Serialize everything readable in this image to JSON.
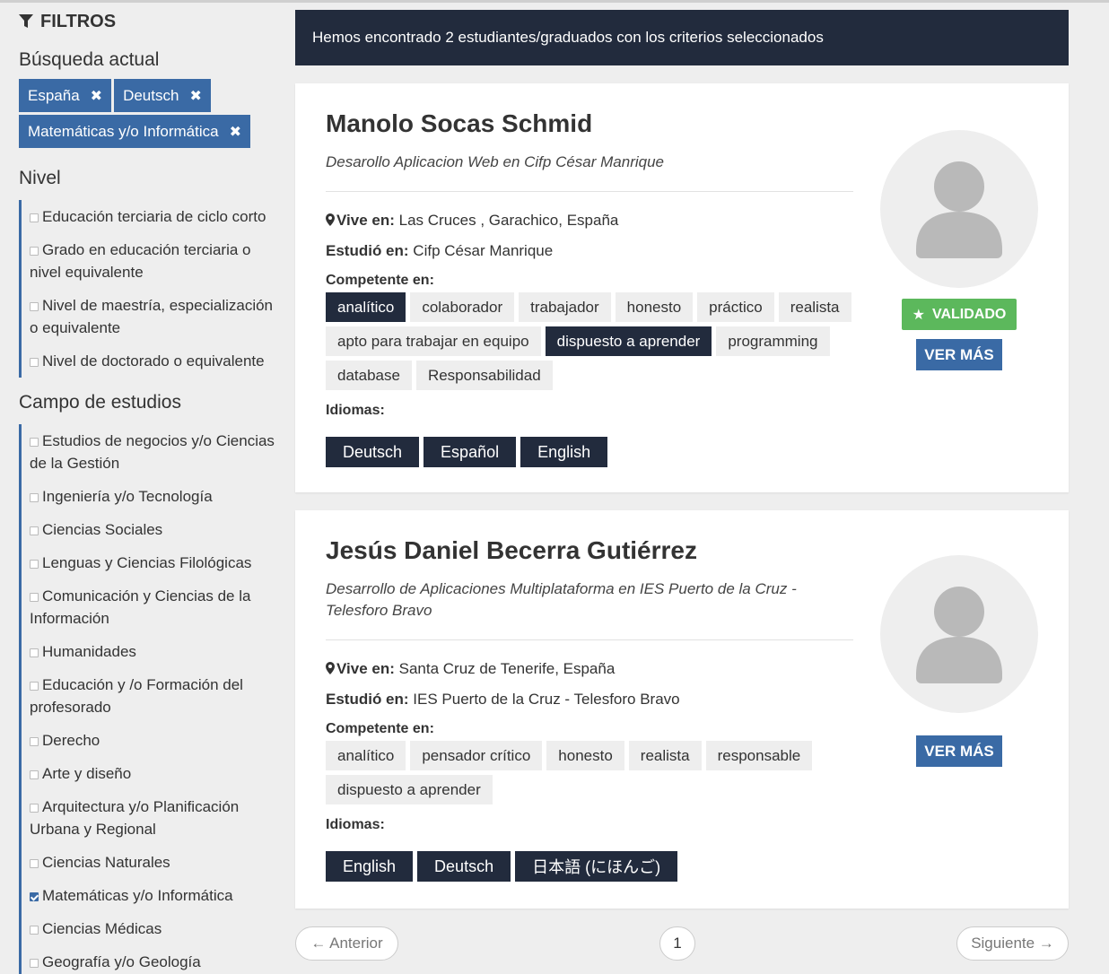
{
  "sidebar": {
    "title": "FILTROS",
    "current_search_title": "Búsqueda actual",
    "chips": [
      {
        "label": "España"
      },
      {
        "label": "Deutsch"
      },
      {
        "label": "Matemáticas y/o Informática"
      }
    ],
    "level_title": "Nivel",
    "levels": [
      {
        "label": "Educación terciaria de ciclo corto",
        "checked": false
      },
      {
        "label": "Grado en educación terciaria o nivel equivalente",
        "checked": false
      },
      {
        "label": "Nivel de maestría, especialización o equivalente",
        "checked": false
      },
      {
        "label": "Nivel de doctorado o equivalente",
        "checked": false
      }
    ],
    "field_title": "Campo de estudios",
    "fields": [
      {
        "label": "Estudios de negocios y/o Ciencias de la Gestión",
        "checked": false
      },
      {
        "label": "Ingeniería y/o Tecnología",
        "checked": false
      },
      {
        "label": "Ciencias Sociales",
        "checked": false
      },
      {
        "label": "Lenguas y Ciencias Filológicas",
        "checked": false
      },
      {
        "label": "Comunicación y Ciencias de la Información",
        "checked": false
      },
      {
        "label": "Humanidades",
        "checked": false
      },
      {
        "label": "Educación y /o Formación del profesorado",
        "checked": false
      },
      {
        "label": "Derecho",
        "checked": false
      },
      {
        "label": "Arte y diseño",
        "checked": false
      },
      {
        "label": "Arquitectura y/o Planificación Urbana y Regional",
        "checked": false
      },
      {
        "label": "Ciencias Naturales",
        "checked": false
      },
      {
        "label": "Matemáticas y/o Informática",
        "checked": true
      },
      {
        "label": "Ciencias Médicas",
        "checked": false
      },
      {
        "label": "Geografía y/o Geología",
        "checked": false
      }
    ]
  },
  "banner": "Hemos encontrado 2 estudiantes/graduados con los criterios seleccionados",
  "labels": {
    "lives": "Vive en:",
    "studied": "Estudió en:",
    "competent": "Competente en:",
    "languages": "Idiomas:",
    "validated": "VALIDADO",
    "more": "VER MÁS"
  },
  "students": [
    {
      "name": "Manolo Socas Schmid",
      "subtitle": "Desarollo Aplicacion Web en Cifp César Manrique",
      "lives": "Las Cruces , Garachico, España",
      "studied": "Cifp César Manrique",
      "validated": true,
      "skills": [
        {
          "label": "analítico",
          "highlight": true
        },
        {
          "label": "colaborador",
          "highlight": false
        },
        {
          "label": "trabajador",
          "highlight": false
        },
        {
          "label": "honesto",
          "highlight": false
        },
        {
          "label": "práctico",
          "highlight": false
        },
        {
          "label": "realista",
          "highlight": false
        },
        {
          "label": "apto para trabajar en equipo",
          "highlight": false
        },
        {
          "label": "dispuesto a aprender",
          "highlight": true
        },
        {
          "label": "programming",
          "highlight": false
        },
        {
          "label": "database",
          "highlight": false
        },
        {
          "label": "Responsabilidad",
          "highlight": false
        }
      ],
      "languages": [
        "Deutsch",
        "Español",
        "English"
      ]
    },
    {
      "name": "Jesús Daniel Becerra Gutiérrez",
      "subtitle": "Desarrollo de Aplicaciones Multiplataforma en IES Puerto de la Cruz - Telesforo Bravo",
      "lives": "Santa Cruz de Tenerife, España",
      "studied": "IES Puerto de la Cruz - Telesforo Bravo",
      "validated": false,
      "skills": [
        {
          "label": "analítico",
          "highlight": false
        },
        {
          "label": "pensador crítico",
          "highlight": false
        },
        {
          "label": "honesto",
          "highlight": false
        },
        {
          "label": "realista",
          "highlight": false
        },
        {
          "label": "responsable",
          "highlight": false
        },
        {
          "label": "dispuesto a aprender",
          "highlight": false
        }
      ],
      "languages": [
        "English",
        "Deutsch",
        "日本語 (にほんご)"
      ]
    }
  ],
  "pagination": {
    "prev": "← Anterior",
    "page": "1",
    "next": "Siguiente →"
  },
  "colors": {
    "accent": "#3a6aa5",
    "dark": "#222b3d",
    "validated": "#5cb85c"
  }
}
